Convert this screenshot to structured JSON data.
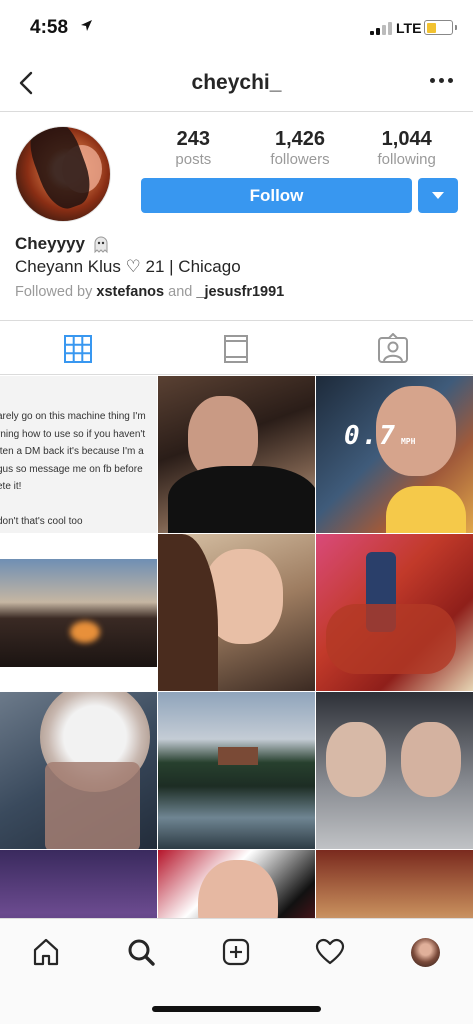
{
  "status_bar": {
    "time": "4:58",
    "network": "LTE",
    "battery_color": "#f2c230"
  },
  "header": {
    "username": "cheychi_",
    "back_icon": "chevron-left-icon",
    "more_icon": "more-horizontal-icon"
  },
  "profile": {
    "stats": [
      {
        "value": "243",
        "label": "posts"
      },
      {
        "value": "1,426",
        "label": "followers"
      },
      {
        "value": "1,044",
        "label": "following"
      }
    ],
    "follow_label": "Follow",
    "follow_color": "#3897f0",
    "display_name": "Cheyyyy",
    "bio": "Cheyann Klus ♡ 21 | Chicago",
    "followed_by_prefix": "Followed by",
    "followed_by_user1": "xstefanos",
    "followed_by_and": "and",
    "followed_by_user2": "_jesusfr1991"
  },
  "tabs": [
    {
      "name": "grid",
      "icon": "grid-icon",
      "active": true,
      "color": "#3897f0"
    },
    {
      "name": "feed",
      "icon": "feed-icon",
      "active": false
    },
    {
      "name": "tagged",
      "icon": "tagged-person-icon",
      "active": false
    }
  ],
  "grid_text_post": {
    "lines": [
      "arely go on this machine thing I'm",
      "rning how to use so if you haven't",
      "tten a DM back it's because I'm a",
      "gus so message me on fb before",
      "ete it!",
      "",
      "don't that's cool too"
    ]
  },
  "grid_overlay_text": "0.7",
  "grid_overlay_unit": "MPH",
  "bottom_nav": [
    {
      "name": "home",
      "icon": "home-icon"
    },
    {
      "name": "search",
      "icon": "search-icon"
    },
    {
      "name": "add",
      "icon": "add-square-icon"
    },
    {
      "name": "activity",
      "icon": "heart-icon"
    },
    {
      "name": "profile",
      "icon": "avatar"
    }
  ]
}
